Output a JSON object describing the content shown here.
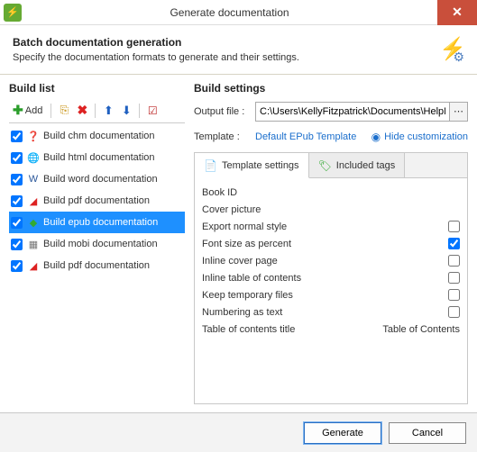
{
  "window": {
    "title": "Generate documentation"
  },
  "header": {
    "title": "Batch documentation generation",
    "subtitle": "Specify the documentation formats to generate and their settings."
  },
  "buildList": {
    "title": "Build list",
    "addLabel": "Add",
    "items": [
      {
        "label": "Build chm documentation",
        "iconClass": "doc-chm",
        "glyph": "❓",
        "checked": true,
        "selected": false
      },
      {
        "label": "Build html documentation",
        "iconClass": "doc-html",
        "glyph": "🌐",
        "checked": true,
        "selected": false
      },
      {
        "label": "Build word documentation",
        "iconClass": "doc-word",
        "glyph": "W",
        "checked": true,
        "selected": false
      },
      {
        "label": "Build pdf documentation",
        "iconClass": "doc-pdf",
        "glyph": "◢",
        "checked": true,
        "selected": false
      },
      {
        "label": "Build epub documentation",
        "iconClass": "doc-epub",
        "glyph": "◆",
        "checked": true,
        "selected": true
      },
      {
        "label": "Build mobi documentation",
        "iconClass": "doc-mobi",
        "glyph": "▦",
        "checked": true,
        "selected": false
      },
      {
        "label": "Build pdf documentation",
        "iconClass": "doc-pdf",
        "glyph": "◢",
        "checked": true,
        "selected": false
      }
    ]
  },
  "buildSettings": {
    "title": "Build settings",
    "outputLabel": "Output file :",
    "outputValue": "C:\\Users\\KellyFitzpatrick\\Documents\\HelpND",
    "templateLabel": "Template :",
    "templateName": "Default EPub Template",
    "hideCustomization": "Hide customization",
    "tabs": {
      "templateSettings": "Template settings",
      "includedTags": "Included tags"
    },
    "settings": [
      {
        "label": "Book ID",
        "type": "text",
        "value": ""
      },
      {
        "label": "Cover picture",
        "type": "text",
        "value": ""
      },
      {
        "label": "Export normal style",
        "type": "check",
        "checked": false
      },
      {
        "label": "Font size as percent",
        "type": "check",
        "checked": true
      },
      {
        "label": "Inline cover page",
        "type": "check",
        "checked": false
      },
      {
        "label": "Inline table of contents",
        "type": "check",
        "checked": false
      },
      {
        "label": "Keep temporary files",
        "type": "check",
        "checked": false
      },
      {
        "label": "Numbering as text",
        "type": "check",
        "checked": false
      },
      {
        "label": "Table of contents title",
        "type": "text",
        "value": "Table of Contents"
      }
    ]
  },
  "footer": {
    "generate": "Generate",
    "cancel": "Cancel"
  }
}
